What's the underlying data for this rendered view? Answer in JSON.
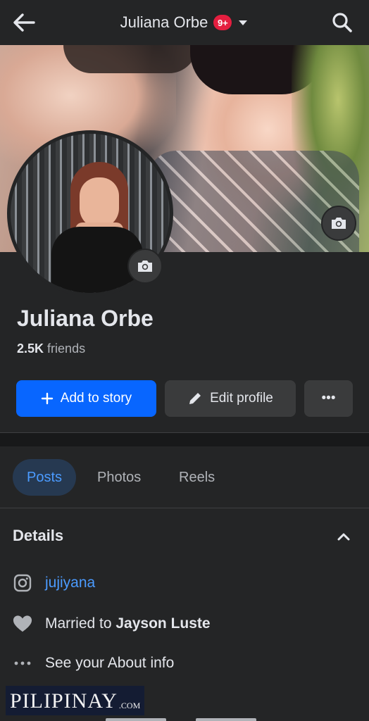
{
  "topbar": {
    "title": "Juliana Orbe",
    "badge": "9+",
    "icons": {
      "back": "arrow-left-icon",
      "caret": "caret-down-icon",
      "search": "search-icon"
    }
  },
  "cover": {
    "image_alt": "cover-photo",
    "camera_icon": "camera-icon"
  },
  "profile": {
    "name": "Juliana Orbe",
    "friends_count": "2.5K",
    "friends_label": "friends"
  },
  "actions": {
    "add_story_label": "Add to story",
    "edit_profile_label": "Edit profile",
    "more_label": "•••"
  },
  "tabs": [
    {
      "label": "Posts",
      "active": true
    },
    {
      "label": "Photos",
      "active": false
    },
    {
      "label": "Reels",
      "active": false
    }
  ],
  "details": {
    "title": "Details",
    "instagram": "jujiyana",
    "married_prefix": "Married to",
    "married_name": "Jayson Luste",
    "about": "See your About info"
  },
  "watermark": {
    "big": "PILIPINAY",
    "small": ".COM"
  },
  "colors": {
    "background": "#242526",
    "accent": "#0866ff",
    "link": "#4b9bff",
    "badge": "#e41e3f"
  }
}
